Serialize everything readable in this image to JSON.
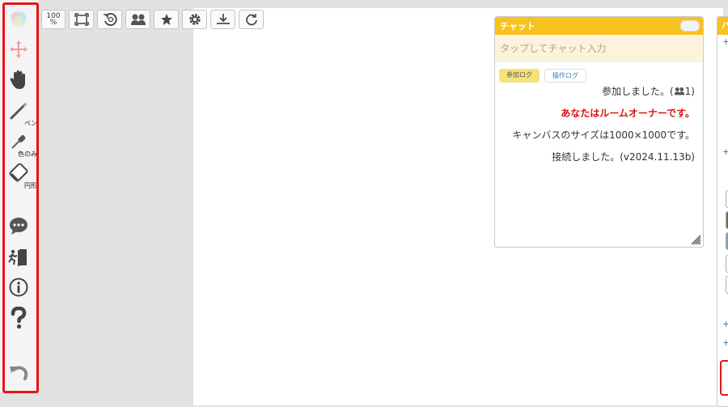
{
  "toolbar_left": {
    "pen_label": "ペン",
    "eyedropper_label": "色のみ",
    "eraser_label": "円形"
  },
  "toolbar_top": {
    "zoom_value": "100",
    "zoom_unit": "%"
  },
  "chat": {
    "title": "チャット",
    "input_placeholder": "タップしてチャット入力",
    "tabs": [
      "参加ログ",
      "操作ログ"
    ],
    "messages": [
      {
        "text": "参加しました。(",
        "count": "1)"
      },
      {
        "text": "あなたはルームオーナーです。"
      },
      {
        "text": "キャンバスのサイズは1000×1000です。"
      },
      {
        "text": "接続しました。(v2024.11.13b)"
      }
    ]
  },
  "right_panel": {
    "title": "パ"
  },
  "colors": {
    "accent": "#f5c21f",
    "highlight": "#e8131a",
    "owner_text": "#d6170f"
  }
}
